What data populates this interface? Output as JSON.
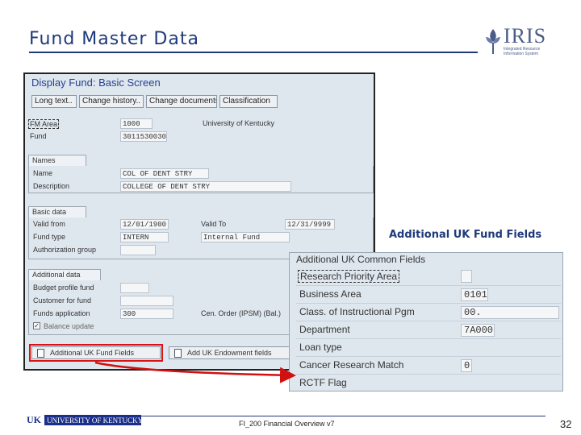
{
  "slide": {
    "title": "Fund Master Data",
    "callout": "Additional UK Fund Fields",
    "footer_text": "FI_200 Financial Overview v7",
    "page_number": "32",
    "footer_logo": "UNIVERSITY OF KENTUCKY",
    "footer_logo_mark": "UK"
  },
  "logo": {
    "word": "IRIS",
    "subtitle": "Integrated Resource Information System"
  },
  "sap": {
    "title": "Display Fund: Basic Screen",
    "toolbar": [
      "Long text..",
      "Change history..",
      "Change documents",
      "Classification"
    ],
    "fm_area_label": "FM Area",
    "fm_area_value": "1000",
    "fm_area_desc": "University of Kentucky",
    "fund_label": "Fund",
    "fund_value": "3011530030",
    "names_header": "Names",
    "name_label": "Name",
    "name_value": "COL OF DENT STRY",
    "description_label": "Description",
    "description_value": "COLLEGE OF DENT STRY",
    "basic_header": "Basic data",
    "valid_from_label": "Valid from",
    "valid_from_value": "12/01/1900",
    "valid_to_label": "Valid To",
    "valid_to_value": "12/31/9999",
    "fund_type_label": "Fund type",
    "fund_type_value": "INTERN",
    "fund_type_desc": "Internal Fund",
    "auth_group_label": "Authorization group",
    "additional_header": "Additional data",
    "budget_profile_label": "Budget profile fund",
    "customer_label": "Customer for fund",
    "funds_app_label": "Funds application",
    "funds_app_value": "300",
    "center_label": "Cen. Order (IPSM) (Bal.)",
    "balance_label": "Balance update",
    "btn_additional": "Additional UK Fund Fields",
    "btn_endowment": "Add UK Endowment fields"
  },
  "uk_panel": {
    "header": "Additional UK Common Fields",
    "rows": [
      {
        "label": "Research Priority Area",
        "value": ""
      },
      {
        "label": "Business Area",
        "value": "0101"
      },
      {
        "label": "Class. of Instructional Pgm",
        "value": "00."
      },
      {
        "label": "Department",
        "value": "7A000"
      },
      {
        "label": "Loan type",
        "value": ""
      },
      {
        "label": "Cancer Research Match",
        "value": "0"
      },
      {
        "label": "RCTF Flag",
        "value": ""
      }
    ]
  },
  "colors": {
    "title_blue": "#1f3a7a",
    "highlight_red": "#d11111",
    "sap_bg": "#dfe7ee"
  }
}
